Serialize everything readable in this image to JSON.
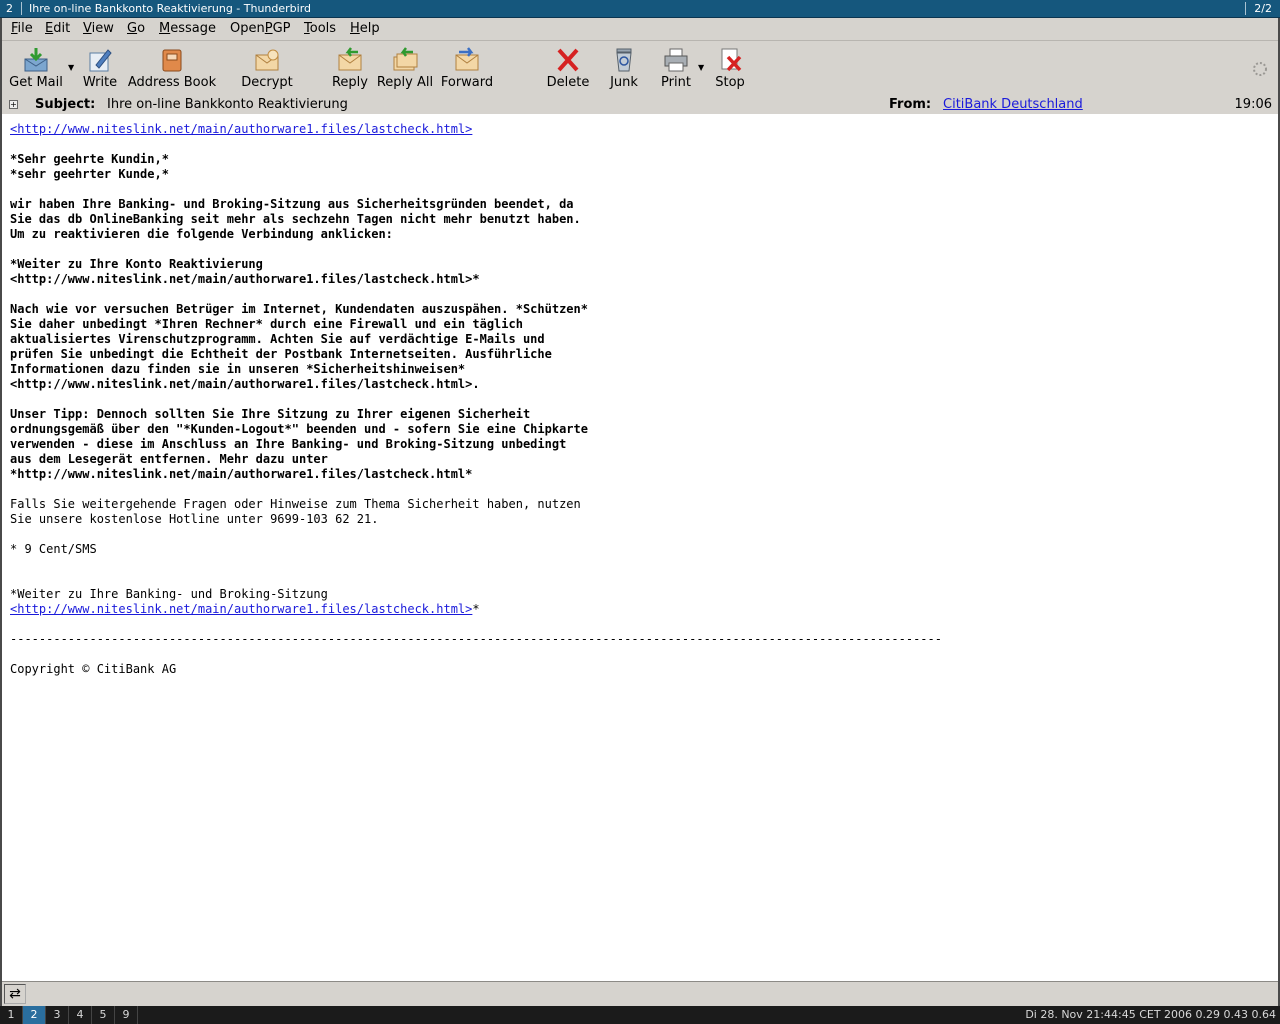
{
  "window": {
    "workspace_number": "2",
    "title": "Ihre on-line Bankkonto Reaktivierung - Thunderbird",
    "window_count": "2/2"
  },
  "menubar": {
    "items": [
      {
        "label": "File",
        "accel": "F",
        "rest": "ile"
      },
      {
        "label": "Edit",
        "accel": "E",
        "rest": "dit"
      },
      {
        "label": "View",
        "accel": "V",
        "rest": "iew"
      },
      {
        "label": "Go",
        "accel": "G",
        "rest": "o"
      },
      {
        "label": "Message",
        "accel": "M",
        "rest": "essage"
      },
      {
        "label": "OpenPGP",
        "accel": "P",
        "pre": "Open",
        "rest": "GP"
      },
      {
        "label": "Tools",
        "accel": "T",
        "rest": "ools"
      },
      {
        "label": "Help",
        "accel": "H",
        "rest": "elp"
      }
    ]
  },
  "toolbar": {
    "get_mail": "Get Mail",
    "write": "Write",
    "address_book": "Address Book",
    "decrypt": "Decrypt",
    "reply": "Reply",
    "reply_all": "Reply All",
    "forward": "Forward",
    "delete": "Delete",
    "junk": "Junk",
    "print": "Print",
    "stop": "Stop"
  },
  "header": {
    "subject_label": "Subject:",
    "subject": "Ihre on-line Bankkonto Reaktivierung",
    "from_label": "From:",
    "from": "CitiBank Deutschland",
    "time": "19:06"
  },
  "body": {
    "link_top": "<http://www.niteslink.net/main/authorware1.files/lastcheck.html>",
    "greeting1": "*Sehr geehrte Kundin,*",
    "greeting2": "*sehr geehrter Kunde,*",
    "p1_l1": "wir haben Ihre Banking- und Broking-Sitzung aus Sicherheitsgründen beendet, da",
    "p1_l2": "Sie das db OnlineBanking seit mehr als sechzehn Tagen nicht mehr benutzt haben.",
    "p1_l3": "Um zu reaktivieren die folgende Verbindung anklicken:",
    "p2_l1": "*Weiter zu Ihre Konto Reaktivierung",
    "p2_l2": "<http://www.niteslink.net/main/authorware1.files/lastcheck.html>*",
    "p3_l1": "Nach wie vor versuchen Betrüger im Internet, Kundendaten auszuspähen. *Schützen*",
    "p3_l2": "Sie daher unbedingt *Ihren Rechner* durch eine Firewall und ein täglich",
    "p3_l3": "aktualisiertes Virenschutzprogramm. Achten Sie auf verdächtige E-Mails und",
    "p3_l4": "prüfen Sie unbedingt die Echtheit der Postbank Internetseiten. Ausführliche",
    "p3_l5": "Informationen dazu finden sie in unseren *Sicherheitshinweisen*",
    "p3_l6": "<http://www.niteslink.net/main/authorware1.files/lastcheck.html>.",
    "p4_l1": "Unser Tipp: Dennoch sollten Sie Ihre Sitzung zu Ihrer eigenen Sicherheit",
    "p4_l2": "ordnungsgemäß über den \"*Kunden-Logout*\" beenden und - sofern Sie eine Chipkarte",
    "p4_l3": "verwenden - diese im Anschluss an Ihre Banking- und Broking-Sitzung unbedingt",
    "p4_l4": "aus dem Lesegerät entfernen. Mehr dazu unter",
    "p4_l5": "*http://www.niteslink.net/main/authorware1.files/lastcheck.html*",
    "p5_l1": "Falls Sie weitergehende Fragen oder Hinweise zum Thema Sicherheit haben, nutzen",
    "p5_l2": "Sie unsere kostenlose Hotline unter 9699-103 62 21.",
    "p6": "* 9 Cent/SMS",
    "p7_l1": "*Weiter zu Ihre Banking- und Broking-Sitzung",
    "p7_link": "<http://www.niteslink.net/main/authorware1.files/lastcheck.html>",
    "p7_tail": "*",
    "rule": "---------------------------------------------------------------------------------------------------------------------------------",
    "copyright": "Copyright © CitiBank AG"
  },
  "taskbar": {
    "workspaces": [
      "1",
      "2",
      "3",
      "4",
      "5",
      "9"
    ],
    "active_workspace": "2",
    "sysinfo": "Di 28. Nov 21:44:45 CET 2006 0.29 0.43 0.64"
  },
  "colors": {
    "titlebar": "#15577d",
    "chrome": "#d6d3ce",
    "link": "#1a1adb"
  }
}
